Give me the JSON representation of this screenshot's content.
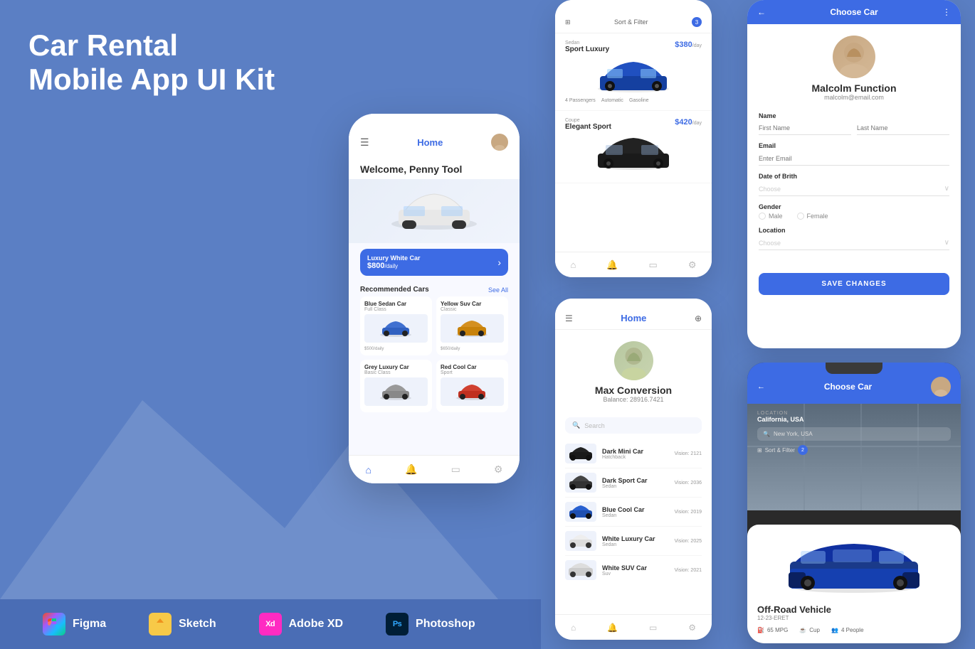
{
  "title": {
    "line1": "Car Rental",
    "line2": "Mobile App UI Kit"
  },
  "tools": [
    {
      "name": "Figma",
      "icon": "figma"
    },
    {
      "name": "Sketch",
      "icon": "sketch"
    },
    {
      "name": "Adobe XD",
      "icon": "xd"
    },
    {
      "name": "Photoshop",
      "icon": "ps"
    }
  ],
  "phone1": {
    "header": "Home",
    "welcome": "Welcome, Penny Tool",
    "featured_car": {
      "name": "Luxury White Car",
      "price": "$800",
      "unit": "/daily"
    },
    "section_title": "Recommended Cars",
    "see_all": "See All",
    "cars": [
      {
        "name": "Blue Sedan Car",
        "class": "Full Class",
        "price": "$500",
        "unit": "/daily"
      },
      {
        "name": "Yellow Suv Car",
        "class": "Classic",
        "price": "$650",
        "unit": "/daily"
      },
      {
        "name": "Grey Luxury Car",
        "class": "Basic Class",
        "price": ""
      },
      {
        "name": "Red Cool Car",
        "class": "Sport",
        "price": ""
      }
    ]
  },
  "car_list_screen": {
    "filter_label": "Sort & Filter",
    "filter_count": "3",
    "cars": [
      {
        "category": "Sedan",
        "name": "Sport Luxury",
        "price": "$380",
        "unit": "/day",
        "specs": [
          "4 Passengers",
          "Automatic",
          "Gasoline"
        ]
      },
      {
        "category": "Coupe",
        "name": "Elegant Sport",
        "price": "$420",
        "unit": "/day",
        "specs": []
      }
    ]
  },
  "profile_screen": {
    "title": "Choose Car",
    "user": {
      "name": "Malcolm Function",
      "email": "malcolm@email.com"
    },
    "form": {
      "name_label": "Name",
      "first_placeholder": "First Name",
      "last_placeholder": "Last Name",
      "email_label": "Email",
      "email_placeholder": "Enter Email",
      "dob_label": "Date of Brith",
      "dob_placeholder": "Choose",
      "gender_label": "Gender",
      "gender_options": [
        "Male",
        "Female"
      ],
      "location_label": "Location",
      "location_placeholder": "Choose"
    },
    "save_button": "SAVE CHANGES"
  },
  "home2_screen": {
    "title": "Home",
    "user": {
      "name": "Max Conversion",
      "balance": "Balance: 28916.7421"
    },
    "search_placeholder": "Search",
    "cars": [
      {
        "name": "Dark Mini Car",
        "type": "Hatchback",
        "views": "Vision: 2121"
      },
      {
        "name": "Dark Sport Car",
        "type": "Sedan",
        "views": "Vision: 2036"
      },
      {
        "name": "Blue Cool Car",
        "type": "Sedan",
        "views": "Vision: 2019"
      },
      {
        "name": "White Luxury Car",
        "type": "Sedan",
        "views": "Vision: 2025"
      },
      {
        "name": "White SUV Car",
        "type": "Suv",
        "views": "Vision: 2021"
      }
    ]
  },
  "choose_dark_screen": {
    "title": "Choose Car",
    "location_label": "LOCATION",
    "location": "California, USA",
    "search_placeholder": "New York, USA",
    "filter_label": "Sort & Filter",
    "filter_count": "2",
    "car": {
      "name": "Off-Road Vehicle",
      "plate": "12-23-ERET",
      "specs": [
        {
          "icon": "⛽",
          "value": "65 MPG"
        },
        {
          "icon": "☕",
          "value": "Cup"
        },
        {
          "icon": "👥",
          "value": "4 People"
        }
      ]
    }
  }
}
